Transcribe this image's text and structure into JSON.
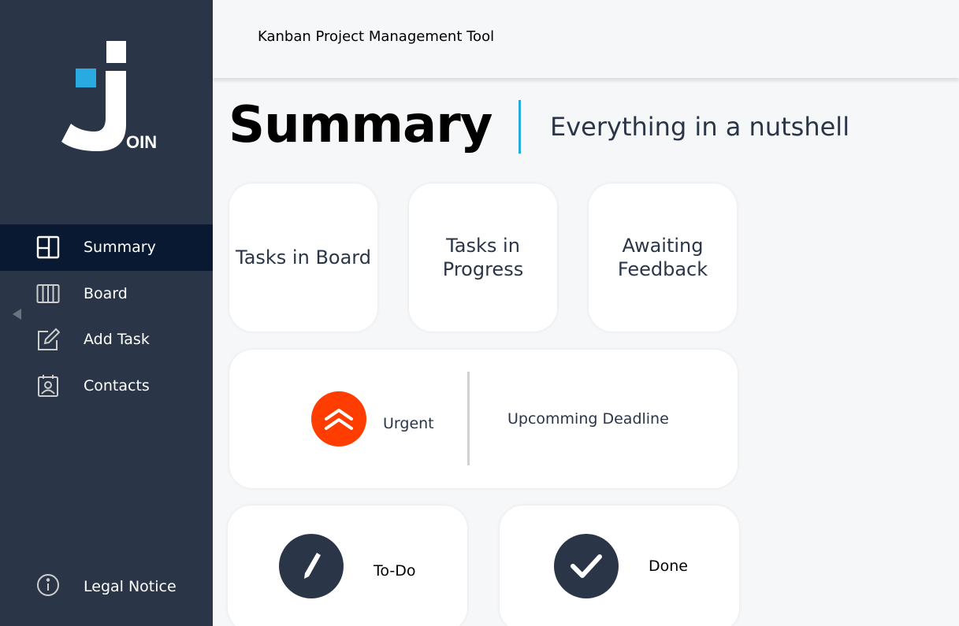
{
  "app": {
    "logo_text": "OIN",
    "header_title": "Kanban Project Management Tool"
  },
  "sidebar": {
    "items": [
      {
        "label": "Summary",
        "icon": "summary-icon",
        "active": true
      },
      {
        "label": "Board",
        "icon": "board-icon",
        "active": false
      },
      {
        "label": "Add Task",
        "icon": "add-task-icon",
        "active": false
      },
      {
        "label": "Contacts",
        "icon": "contacts-icon",
        "active": false
      }
    ],
    "legal_label": "Legal Notice"
  },
  "main": {
    "title": "Summary",
    "subtitle": "Everything in a nutshell",
    "cards": {
      "tasks_in_board": "Tasks in Board",
      "tasks_in_progress_line1": "Tasks in",
      "tasks_in_progress_line2": "Progress",
      "awaiting_feedback_line1": "Awaiting",
      "awaiting_feedback_line2": "Feedback",
      "urgent": "Urgent",
      "upcoming_deadline": "Upcomming Deadline",
      "todo": "To-Do",
      "done": "Done"
    }
  },
  "colors": {
    "sidebar_bg": "#2a3647",
    "sidebar_active": "#091931",
    "accent": "#29abe2",
    "urgent": "#ff3d00",
    "page_bg": "#f6f7f8"
  }
}
